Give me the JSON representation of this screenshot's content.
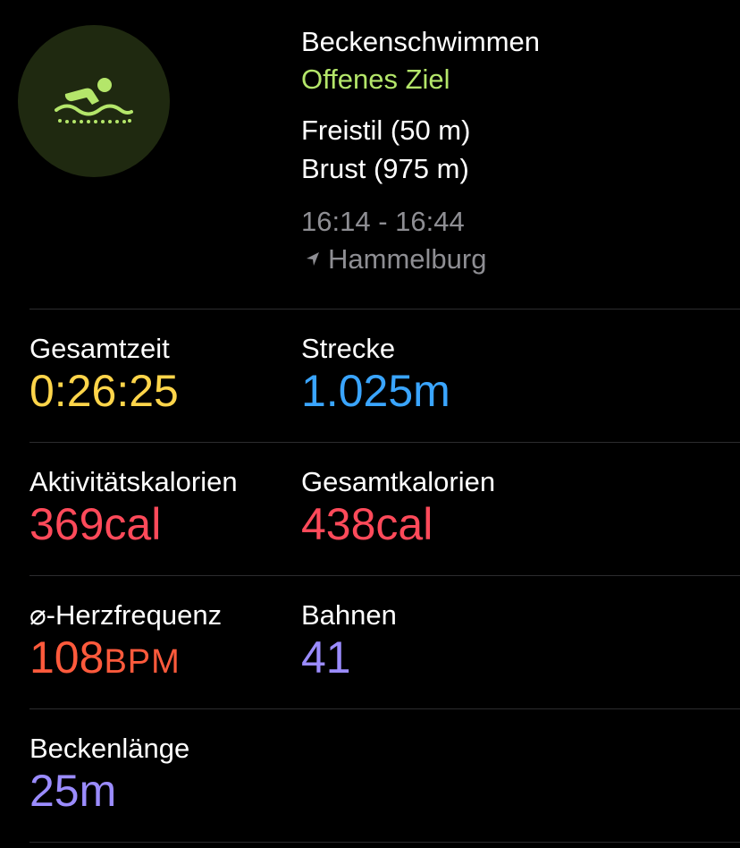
{
  "header": {
    "icon": "swimmer-icon",
    "icon_color": "#b4e66a",
    "icon_bg": "#1f2910",
    "workout_name": "Beckenschwimmen",
    "goal": "Offenes Ziel",
    "strokes": [
      "Freistil (50 m)",
      "Brust (975 m)"
    ],
    "time_range": "16:14 - 16:44",
    "location_icon": "location-arrow-icon",
    "location": "Hammelburg"
  },
  "metrics": {
    "total_time": {
      "label": "Gesamtzeit",
      "value": "0:26:25",
      "color": "#ffd54a"
    },
    "distance": {
      "label": "Strecke",
      "value": "1.025m",
      "color": "#3aa5ff"
    },
    "active_calories": {
      "label": "Aktivitätskalorien",
      "value": "369cal",
      "color": "#ff4a5a"
    },
    "total_calories": {
      "label": "Gesamtkalorien",
      "value": "438cal",
      "color": "#ff4a5a"
    },
    "avg_heart_rate": {
      "label": "⌀-Herzfrequenz",
      "value": "108",
      "unit": "BPM",
      "color": "#ff5a3c"
    },
    "laps": {
      "label": "Bahnen",
      "value": "41",
      "color": "#9b8cff"
    },
    "pool_length": {
      "label": "Beckenlänge",
      "value": "25m",
      "color": "#9b8cff"
    }
  }
}
